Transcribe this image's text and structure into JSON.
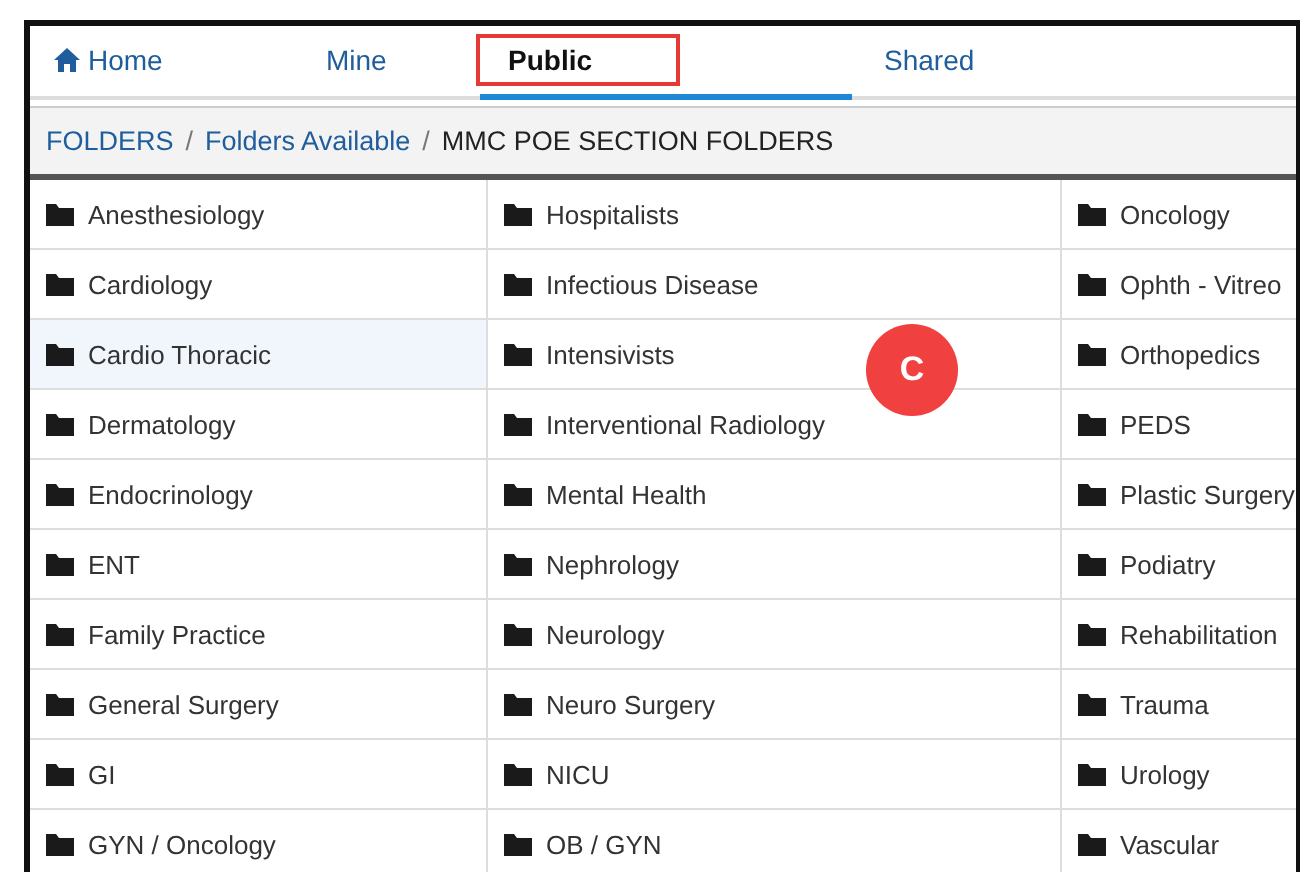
{
  "tabs": [
    {
      "label": "Home",
      "kind": "home",
      "selected": false,
      "outlined": false
    },
    {
      "label": "Mine",
      "kind": "plain",
      "selected": false,
      "outlined": false
    },
    {
      "label": "Public",
      "kind": "plain",
      "selected": true,
      "outlined": true
    },
    {
      "label": "Shared",
      "kind": "plain",
      "selected": false,
      "outlined": false
    }
  ],
  "breadcrumb_separator": "/",
  "breadcrumb": [
    {
      "label": "FOLDERS",
      "kind": "link"
    },
    {
      "label": "Folders Available",
      "kind": "link"
    },
    {
      "label": "MMC POE SECTION FOLDERS",
      "kind": "current"
    }
  ],
  "columns": [
    {
      "folders": [
        {
          "name": "Anesthesiology",
          "selected": false
        },
        {
          "name": "Cardiology",
          "selected": false
        },
        {
          "name": "Cardio Thoracic",
          "selected": true
        },
        {
          "name": "Dermatology",
          "selected": false
        },
        {
          "name": "Endocrinology",
          "selected": false
        },
        {
          "name": "ENT",
          "selected": false
        },
        {
          "name": "Family Practice",
          "selected": false
        },
        {
          "name": "General Surgery",
          "selected": false
        },
        {
          "name": "GI",
          "selected": false
        },
        {
          "name": "GYN / Oncology",
          "selected": false
        }
      ]
    },
    {
      "folders": [
        {
          "name": "Hospitalists",
          "selected": false
        },
        {
          "name": "Infectious Disease",
          "selected": false
        },
        {
          "name": "Intensivists",
          "selected": false
        },
        {
          "name": "Interventional Radiology",
          "selected": false
        },
        {
          "name": "Mental Health",
          "selected": false
        },
        {
          "name": "Nephrology",
          "selected": false
        },
        {
          "name": "Neurology",
          "selected": false
        },
        {
          "name": "Neuro Surgery",
          "selected": false
        },
        {
          "name": "NICU",
          "selected": false
        },
        {
          "name": "OB / GYN",
          "selected": false
        }
      ]
    },
    {
      "folders": [
        {
          "name": "Oncology",
          "selected": false
        },
        {
          "name": "Ophth - Vitreo",
          "selected": false
        },
        {
          "name": "Orthopedics",
          "selected": false
        },
        {
          "name": "PEDS",
          "selected": false
        },
        {
          "name": "Plastic Surgery",
          "selected": false
        },
        {
          "name": "Podiatry",
          "selected": false
        },
        {
          "name": "Rehabilitation",
          "selected": false
        },
        {
          "name": "Trauma",
          "selected": false
        },
        {
          "name": "Urology",
          "selected": false
        },
        {
          "name": "Vascular",
          "selected": false
        }
      ]
    }
  ],
  "annotation_badge": {
    "label": "C"
  }
}
